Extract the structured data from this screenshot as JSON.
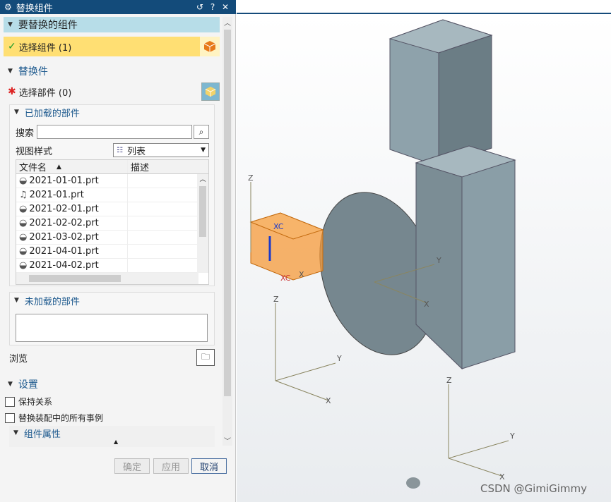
{
  "title": "替换组件",
  "section_replace": {
    "title": "要替换的组件",
    "select_label": "选择组件 (1)"
  },
  "section_replacement": {
    "title": "替换件",
    "select_parts_label": "选择部件 (0)",
    "loaded": {
      "title": "已加载的部件",
      "search_label": "搜索",
      "search_value": "",
      "view_style_label": "视图样式",
      "view_style_value": "列表",
      "columns": [
        "文件名",
        "描述"
      ],
      "files": [
        "2021-01-01.prt",
        "2021-01.prt",
        "2021-02-01.prt",
        "2021-02-02.prt",
        "2021-03-02.prt",
        "2021-04-01.prt",
        "2021-04-02.prt"
      ]
    },
    "unloaded": {
      "title": "未加载的部件"
    },
    "browse_label": "浏览"
  },
  "settings": {
    "title": "设置",
    "keep_relations": "保持关系",
    "replace_all": "替换装配中的所有事例",
    "component_props": "组件属性"
  },
  "buttons": {
    "ok": "确定",
    "apply": "应用",
    "cancel": "取消"
  },
  "viewport_labels": {
    "z": "Z",
    "y": "Y",
    "x": "X",
    "xc": "XC",
    "watermark": "CSDN @GimiGimmy"
  },
  "colors": {
    "titlebar": "#134b7a",
    "highlight": "#ffdf73",
    "section": "#b7dde8",
    "part_fill": "#7a8a92",
    "orange": "#f59a3a"
  }
}
